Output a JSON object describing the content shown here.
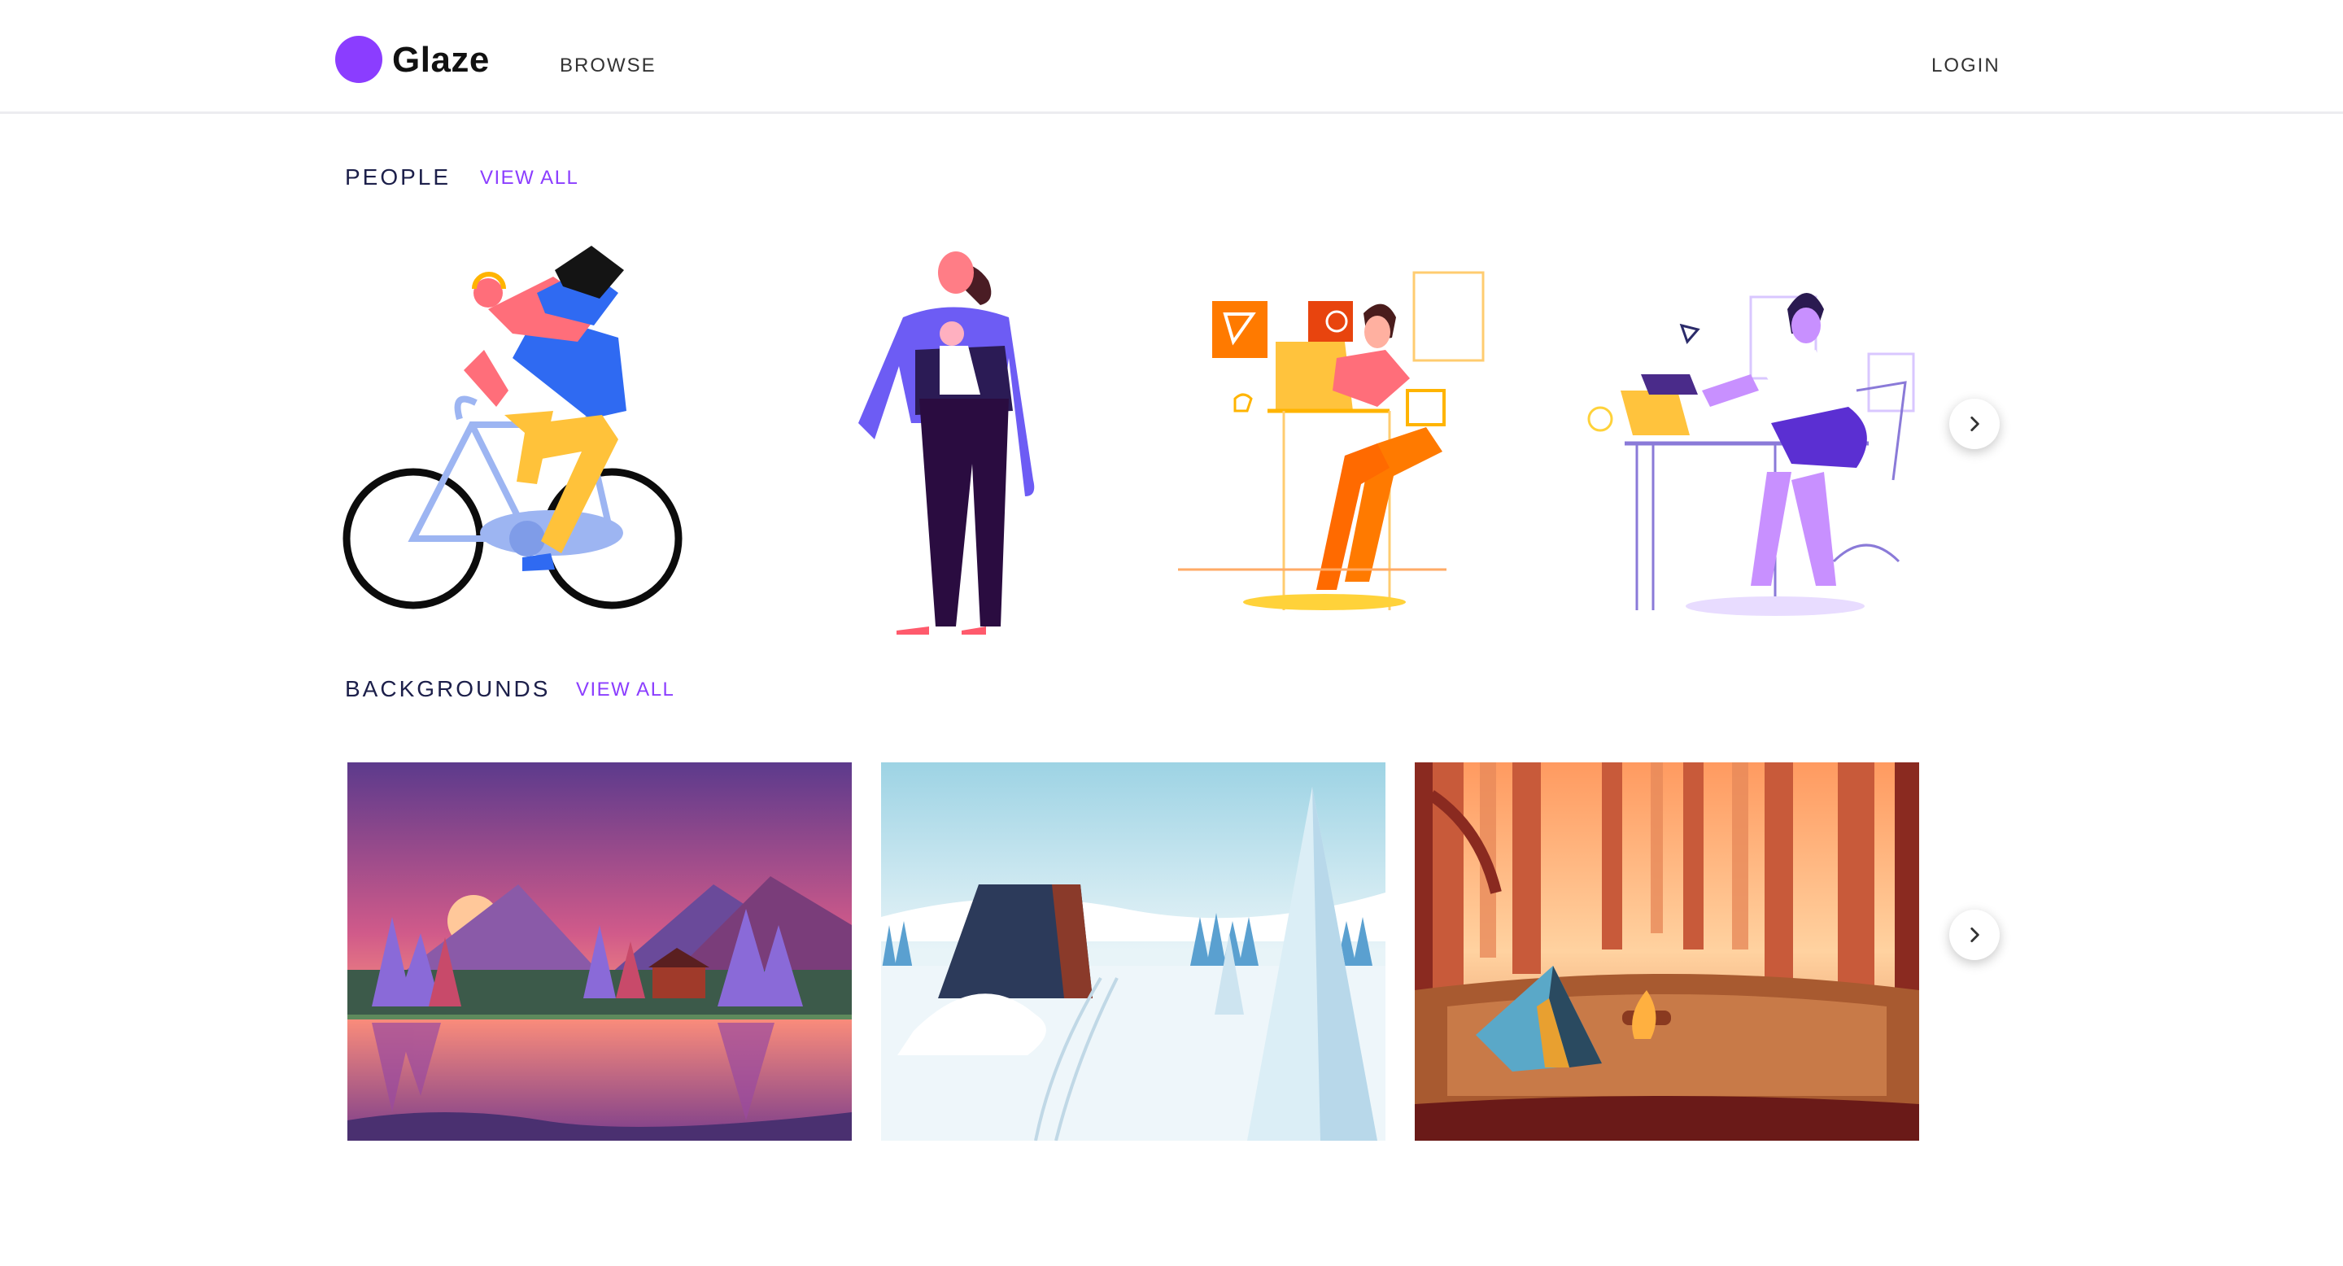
{
  "header": {
    "logo_text": "Glaze",
    "nav_browse": "BROWSE",
    "nav_login": "LOGIN"
  },
  "sections": {
    "people": {
      "title": "PEOPLE",
      "view_all": "VIEW ALL",
      "items": [
        "cyclist-illustration",
        "parent-with-baby-illustration",
        "designer-at-desk-illustration",
        "woman-at-laptop-illustration"
      ]
    },
    "backgrounds": {
      "title": "BACKGROUNDS",
      "view_all": "VIEW ALL",
      "items": [
        "sunset-lake-landscape",
        "snowy-cabin-landscape",
        "forest-campsite-landscape"
      ]
    }
  },
  "icons": {
    "next": "chevron-right-icon"
  },
  "colors": {
    "brand": "#8b3dff",
    "title": "#1c1f4a",
    "link": "#8b3dff"
  }
}
